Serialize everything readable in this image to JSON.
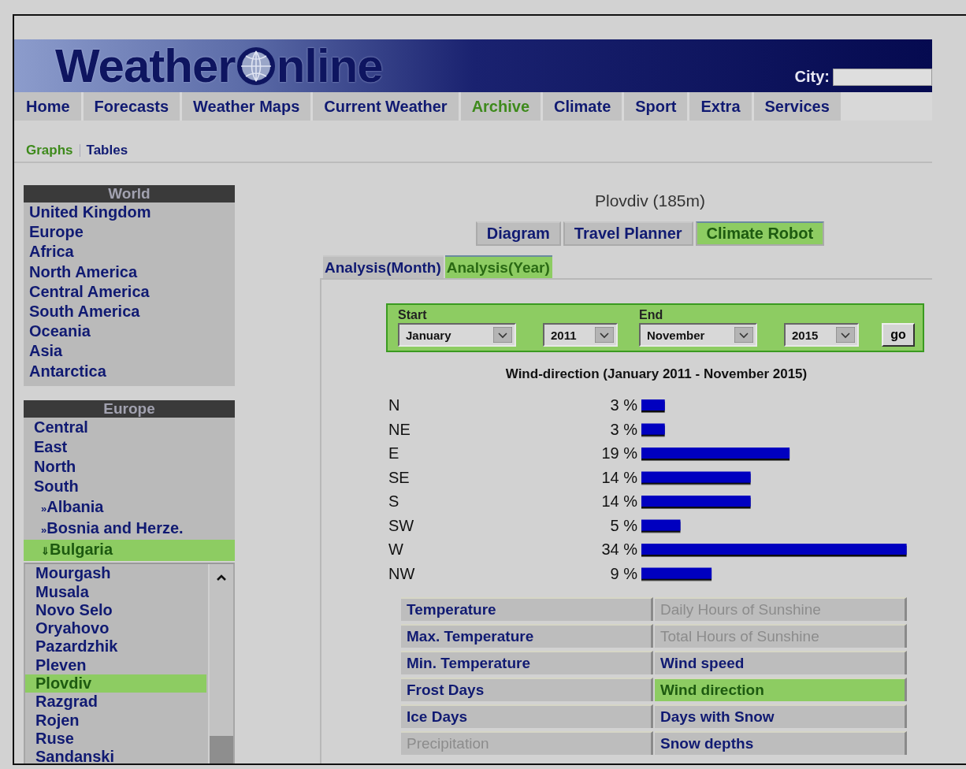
{
  "header": {
    "logo_left": "Weather",
    "logo_right": "nline",
    "city_label": "City:"
  },
  "nav": [
    {
      "label": "Home",
      "selected": false
    },
    {
      "label": "Forecasts",
      "selected": false
    },
    {
      "label": "Weather Maps",
      "selected": false
    },
    {
      "label": "Current Weather",
      "selected": false
    },
    {
      "label": "Archive",
      "selected": true
    },
    {
      "label": "Climate",
      "selected": false
    },
    {
      "label": "Sport",
      "selected": false
    },
    {
      "label": "Extra",
      "selected": false
    },
    {
      "label": "Services",
      "selected": false
    }
  ],
  "subnav": [
    {
      "label": "Graphs",
      "selected": true
    },
    {
      "label": "Tables",
      "selected": false
    }
  ],
  "sidebar": {
    "world": {
      "title": "World",
      "items": [
        "United Kingdom",
        "Europe",
        "Africa",
        "North America",
        "Central America",
        "South America",
        "Oceania",
        "Asia",
        "Antarctica"
      ]
    },
    "europe": {
      "title": "Europe",
      "items": [
        {
          "label": "Central",
          "kind": "region",
          "selected": false
        },
        {
          "label": "East",
          "kind": "region",
          "selected": false
        },
        {
          "label": "North",
          "kind": "region",
          "selected": false
        },
        {
          "label": "South",
          "kind": "region",
          "selected": false
        },
        {
          "label": "Albania",
          "kind": "country",
          "marker": "»",
          "selected": false
        },
        {
          "label": "Bosnia and Herze.",
          "kind": "country",
          "marker": "»",
          "selected": false
        },
        {
          "label": "Bulgaria",
          "kind": "country",
          "marker": "⇓",
          "selected": true
        }
      ]
    },
    "stations": [
      {
        "label": "Mourgash",
        "selected": false
      },
      {
        "label": "Musala",
        "selected": false
      },
      {
        "label": "Novo Selo",
        "selected": false
      },
      {
        "label": "Oryahovo",
        "selected": false
      },
      {
        "label": "Pazardzhik",
        "selected": false
      },
      {
        "label": "Pleven",
        "selected": false
      },
      {
        "label": "Plovdiv",
        "selected": true
      },
      {
        "label": "Razgrad",
        "selected": false
      },
      {
        "label": "Rojen",
        "selected": false
      },
      {
        "label": "Ruse",
        "selected": false
      },
      {
        "label": "Sandanski",
        "selected": false
      }
    ]
  },
  "main": {
    "location_title": "Plovdiv (185m)",
    "view_tabs": [
      {
        "label": "Diagram",
        "selected": false
      },
      {
        "label": "Travel Planner",
        "selected": false
      },
      {
        "label": "Climate Robot",
        "selected": true
      }
    ],
    "analysis_tabs": [
      {
        "label": "Analysis(Month)",
        "selected": false
      },
      {
        "label": "Analysis(Year)",
        "selected": true
      }
    ],
    "period_form": {
      "start_label": "Start",
      "end_label": "End",
      "start_month": "January",
      "start_year": "2011",
      "end_month": "November",
      "end_year": "2015",
      "submit": "go"
    },
    "chart_data": {
      "type": "bar",
      "orientation": "horizontal",
      "title": "Wind-direction (January 2011 - November 2015)",
      "categories": [
        "N",
        "NE",
        "E",
        "SE",
        "S",
        "SW",
        "W",
        "NW"
      ],
      "values": [
        3,
        3,
        19,
        14,
        14,
        5,
        34,
        9
      ],
      "value_labels": [
        "3 %",
        "3 %",
        "19 %",
        "14 %",
        "14 %",
        "5 %",
        "34 %",
        "9 %"
      ]
    },
    "parameters": [
      {
        "label": "Temperature",
        "disabled": false,
        "selected": false
      },
      {
        "label": "Daily Hours of Sunshine",
        "disabled": true,
        "selected": false
      },
      {
        "label": "Max. Temperature",
        "disabled": false,
        "selected": false
      },
      {
        "label": "Total Hours of Sunshine",
        "disabled": true,
        "selected": false
      },
      {
        "label": "Min. Temperature",
        "disabled": false,
        "selected": false
      },
      {
        "label": "Wind speed",
        "disabled": false,
        "selected": false
      },
      {
        "label": "Frost Days",
        "disabled": false,
        "selected": false
      },
      {
        "label": "Wind direction",
        "disabled": false,
        "selected": true
      },
      {
        "label": "Ice Days",
        "disabled": false,
        "selected": false
      },
      {
        "label": "Days with Snow",
        "disabled": false,
        "selected": false
      },
      {
        "label": "Precipitation",
        "disabled": true,
        "selected": false
      },
      {
        "label": "Snow depths",
        "disabled": false,
        "selected": false
      }
    ]
  }
}
